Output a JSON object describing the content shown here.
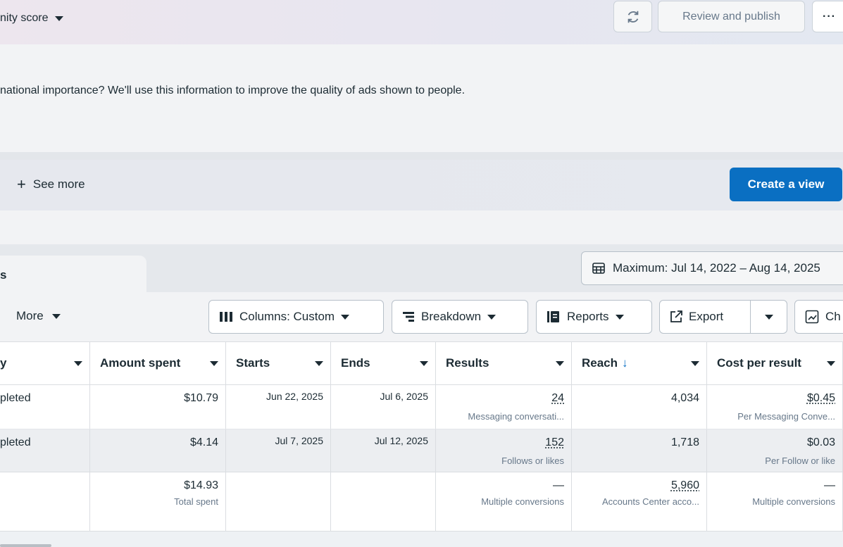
{
  "header": {
    "opportunity_label": "nity score",
    "review_publish_label": "Review and publish",
    "more_label": "···"
  },
  "notice": {
    "text": "national importance? We'll use this information to improve the quality of ads shown to people."
  },
  "views": {
    "see_more_label": "See more",
    "create_view_label": "Create a view"
  },
  "tabs": {
    "active_tab_label": "s",
    "date_range_label": "Maximum: Jul 14, 2022 – Aug 14, 2025"
  },
  "toolbar": {
    "more_label": "More",
    "columns_label": "Columns: Custom",
    "breakdown_label": "Breakdown",
    "reports_label": "Reports",
    "export_label": "Export",
    "chart_label": "Ch"
  },
  "table": {
    "headers": [
      "y",
      "Amount spent",
      "Starts",
      "Ends",
      "Results",
      "Reach",
      "Cost per result"
    ],
    "rows": [
      {
        "delivery": "pleted",
        "amount_spent": "$10.79",
        "starts": "Jun 22, 2025",
        "ends": "Jul 6, 2025",
        "results": "24",
        "results_sub": "Messaging conversati...",
        "reach": "4,034",
        "cost": "$0.45",
        "cost_sub": "Per Messaging Conve..."
      },
      {
        "delivery": "pleted",
        "amount_spent": "$4.14",
        "starts": "Jul 7, 2025",
        "ends": "Jul 12, 2025",
        "results": "152",
        "results_sub": "Follows or likes",
        "reach": "1,718",
        "cost": "$0.03",
        "cost_sub": "Per Follow or like"
      }
    ],
    "totals": {
      "amount_spent": "$14.93",
      "amount_sub": "Total spent",
      "results": "—",
      "results_sub": "Multiple conversions",
      "reach": "5,960",
      "reach_sub": "Accounts Center acco...",
      "cost": "—",
      "cost_sub": "Multiple conversions"
    }
  },
  "colors": {
    "primary_button": "#0a6fc2",
    "sort_arrow": "#0a6fc2"
  }
}
